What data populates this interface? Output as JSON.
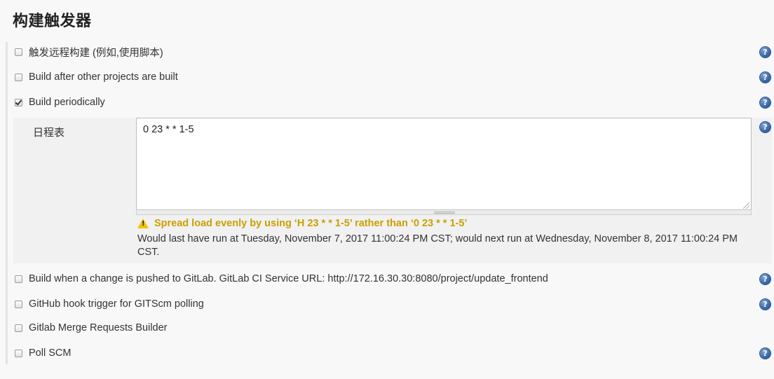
{
  "section": {
    "title": "构建触发器"
  },
  "triggers": [
    {
      "label": "触发远程构建 (例如,使用脚本)",
      "checked": false,
      "has_help": true
    },
    {
      "label": "Build after other projects are built",
      "checked": false,
      "has_help": true
    },
    {
      "label": "Build periodically",
      "checked": true,
      "has_help": true
    },
    {
      "label": "Build when a change is pushed to GitLab. GitLab CI Service URL: http://172.16.30.30:8080/project/update_frontend",
      "checked": false,
      "has_help": true
    },
    {
      "label": "GitHub hook trigger for GITScm polling",
      "checked": false,
      "has_help": true
    },
    {
      "label": "Gitlab Merge Requests Builder",
      "checked": false,
      "has_help": false
    },
    {
      "label": "Poll SCM",
      "checked": false,
      "has_help": true
    }
  ],
  "schedule": {
    "label": "日程表",
    "value": "0 23 * * 1-5",
    "warning": "Spread load evenly by using ‘H 23 * * 1-5’ rather than ‘0 23 * * 1-5’",
    "run_info": "Would last have run at Tuesday, November 7, 2017 11:00:24 PM CST; would next run at Wednesday, November 8, 2017 11:00:24 PM CST."
  },
  "help_icon_glyph": "?",
  "warning_icon_glyph": "!",
  "colors": {
    "warning_text": "#c9a000",
    "help_icon": "#2f5f9e"
  }
}
